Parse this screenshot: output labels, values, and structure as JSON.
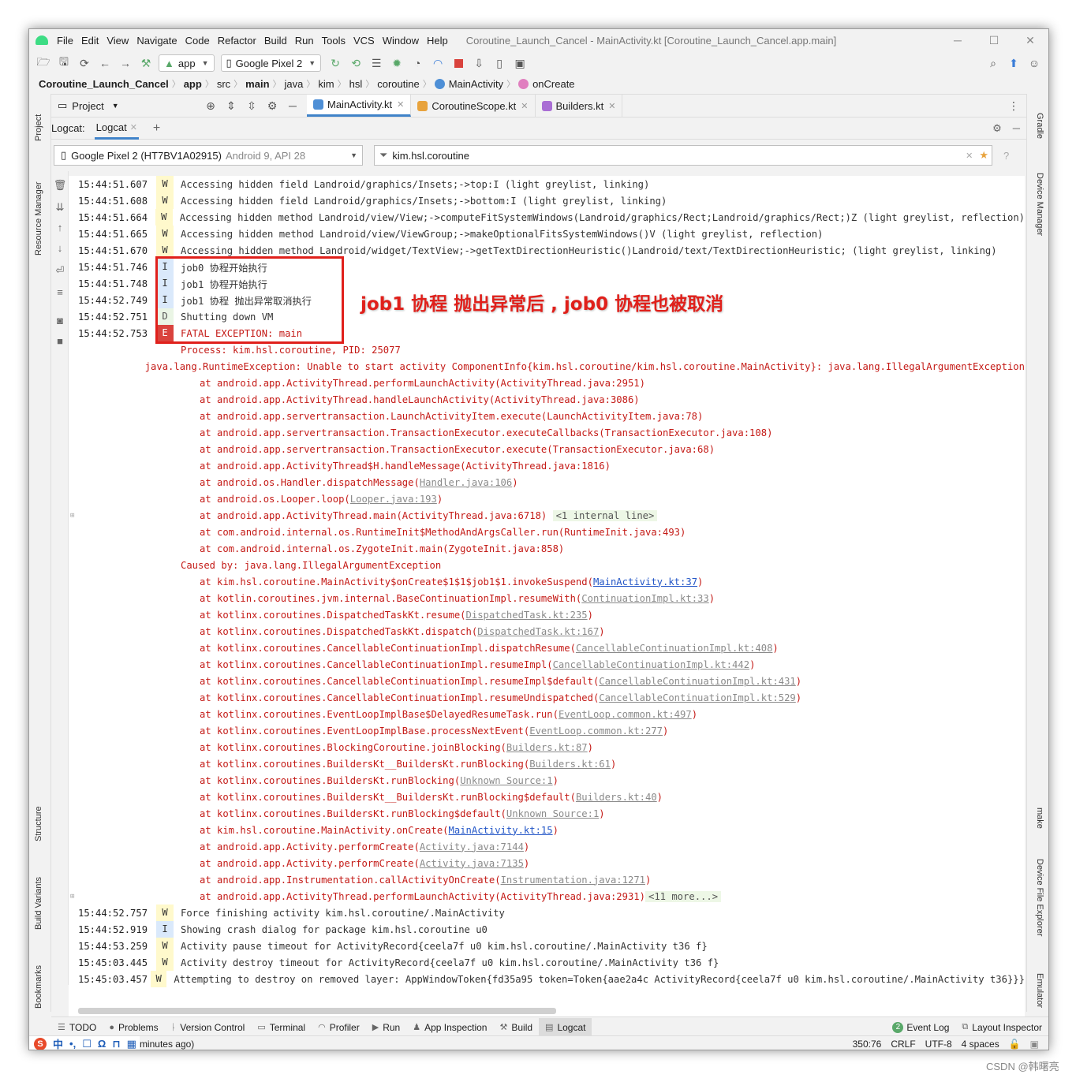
{
  "window": {
    "menus": [
      "File",
      "Edit",
      "View",
      "Navigate",
      "Code",
      "Refactor",
      "Build",
      "Run",
      "Tools",
      "VCS",
      "Window",
      "Help"
    ],
    "title": "Coroutine_Launch_Cancel - MainActivity.kt [Coroutine_Launch_Cancel.app.main]",
    "controls": {
      "min": "─",
      "max": "☐",
      "close": "✕"
    }
  },
  "toolbar": {
    "module": "app",
    "device": "Google Pixel 2"
  },
  "breadcrumb": [
    "Coroutine_Launch_Cancel",
    "app",
    "src",
    "main",
    "java",
    "kim",
    "hsl",
    "coroutine",
    "MainActivity",
    "onCreate"
  ],
  "project_tool": {
    "label": "Project"
  },
  "editor_tabs": [
    {
      "label": "MainActivity.kt",
      "color": "#4e8fd6"
    },
    {
      "label": "CoroutineScope.kt",
      "color": "#e8a33d"
    },
    {
      "label": "Builders.kt",
      "color": "#a96ed4"
    }
  ],
  "left_tools": [
    "Project",
    "Resource Manager",
    "Structure",
    "Build Variants",
    "Bookmarks"
  ],
  "right_tools": [
    "Gradle",
    "Device Manager",
    "make",
    "Device File Explorer",
    "Emulator"
  ],
  "logcat": {
    "header_label": "Logcat:",
    "tab": "Logcat",
    "device": "Google Pixel 2 (HT7BV1A02915)",
    "device_api": "Android 9, API 28",
    "filter": "kim.hsl.coroutine"
  },
  "annotation": "job1 协程 抛出异常后 , job0 协程也被取消",
  "log_rows": [
    {
      "ts": "15:44:51.607",
      "lvl": "W",
      "cls": "warn",
      "msg": "Accessing hidden field Landroid/graphics/Insets;->top:I (light greylist, linking)"
    },
    {
      "ts": "15:44:51.608",
      "lvl": "W",
      "cls": "warn",
      "msg": "Accessing hidden field Landroid/graphics/Insets;->bottom:I (light greylist, linking)"
    },
    {
      "ts": "15:44:51.664",
      "lvl": "W",
      "cls": "warn",
      "msg": "Accessing hidden method Landroid/view/View;->computeFitSystemWindows(Landroid/graphics/Rect;Landroid/graphics/Rect;)Z (light greylist, reflection)"
    },
    {
      "ts": "15:44:51.665",
      "lvl": "W",
      "cls": "warn",
      "msg": "Accessing hidden method Landroid/view/ViewGroup;->makeOptionalFitsSystemWindows()V (light greylist, reflection)"
    },
    {
      "ts": "15:44:51.670",
      "lvl": "W",
      "cls": "warn",
      "msg": "Accessing hidden method Landroid/widget/TextView;->getTextDirectionHeuristic()Landroid/text/TextDirectionHeuristic; (light greylist, linking)"
    },
    {
      "ts": "15:44:51.746",
      "lvl": "I",
      "cls": "warn",
      "msg": "job0 协程开始执行"
    },
    {
      "ts": "15:44:51.748",
      "lvl": "I",
      "cls": "warn",
      "msg": "job1 协程开始执行"
    },
    {
      "ts": "15:44:52.749",
      "lvl": "I",
      "cls": "warn",
      "msg": "job1 协程 抛出异常取消执行"
    },
    {
      "ts": "15:44:52.751",
      "lvl": "D",
      "cls": "warn",
      "msg": "Shutting down VM"
    },
    {
      "ts": "15:44:52.753",
      "lvl": "E",
      "cls": "err",
      "msg": "FATAL EXCEPTION: main"
    },
    {
      "ts": "",
      "lvl": "N",
      "cls": "err",
      "msg": "Process: kim.hsl.coroutine, PID: 25077"
    },
    {
      "ts": "",
      "lvl": "N",
      "cls": "err",
      "msg": "java.lang.RuntimeException: Unable to start activity ComponentInfo{kim.hsl.coroutine/kim.hsl.coroutine.MainActivity}: java.lang.IllegalArgumentException"
    },
    {
      "ts": "",
      "lvl": "N",
      "cls": "at",
      "msg": "at android.app.ActivityThread.performLaunchActivity(ActivityThread.java:2951)"
    },
    {
      "ts": "",
      "lvl": "N",
      "cls": "at",
      "msg": "at android.app.ActivityThread.handleLaunchActivity(ActivityThread.java:3086)"
    },
    {
      "ts": "",
      "lvl": "N",
      "cls": "at",
      "msg": "at android.app.servertransaction.LaunchActivityItem.execute(LaunchActivityItem.java:78)"
    },
    {
      "ts": "",
      "lvl": "N",
      "cls": "at",
      "msg": "at android.app.servertransaction.TransactionExecutor.executeCallbacks(TransactionExecutor.java:108)"
    },
    {
      "ts": "",
      "lvl": "N",
      "cls": "at",
      "msg": "at android.app.servertransaction.TransactionExecutor.execute(TransactionExecutor.java:68)"
    },
    {
      "ts": "",
      "lvl": "N",
      "cls": "at",
      "msg": "at android.app.ActivityThread$H.handleMessage(ActivityThread.java:1816)"
    },
    {
      "ts": "",
      "lvl": "N",
      "cls": "at",
      "msg": "at android.os.Handler.dispatchMessage(",
      "link": "Handler.java:106",
      "tail": ")"
    },
    {
      "ts": "",
      "lvl": "N",
      "cls": "at",
      "msg": "at android.os.Looper.loop(",
      "link": "Looper.java:193",
      "tail": ")"
    },
    {
      "ts": "",
      "lvl": "N",
      "cls": "at",
      "msg": "at android.app.ActivityThread.main(ActivityThread.java:6718) ",
      "inline": "<1 internal line>",
      "fold": true
    },
    {
      "ts": "",
      "lvl": "N",
      "cls": "at",
      "msg": "at com.android.internal.os.RuntimeInit$MethodAndArgsCaller.run(RuntimeInit.java:493)"
    },
    {
      "ts": "",
      "lvl": "N",
      "cls": "at",
      "msg": "at com.android.internal.os.ZygoteInit.main(ZygoteInit.java:858)"
    },
    {
      "ts": "",
      "lvl": "N",
      "cls": "err",
      "msg": "Caused by: java.lang.IllegalArgumentException"
    },
    {
      "ts": "",
      "lvl": "N",
      "cls": "at",
      "msg": "at kim.hsl.coroutine.MainActivity$onCreate$1$1$job1$1.invokeSuspend(",
      "link": "MainActivity.kt:37",
      "src": true,
      "tail": ")"
    },
    {
      "ts": "",
      "lvl": "N",
      "cls": "at",
      "msg": "at kotlin.coroutines.jvm.internal.BaseContinuationImpl.resumeWith(",
      "link": "ContinuationImpl.kt:33",
      "tail": ")"
    },
    {
      "ts": "",
      "lvl": "N",
      "cls": "at",
      "msg": "at kotlinx.coroutines.DispatchedTaskKt.resume(",
      "link": "DispatchedTask.kt:235",
      "tail": ")"
    },
    {
      "ts": "",
      "lvl": "N",
      "cls": "at",
      "msg": "at kotlinx.coroutines.DispatchedTaskKt.dispatch(",
      "link": "DispatchedTask.kt:167",
      "tail": ")"
    },
    {
      "ts": "",
      "lvl": "N",
      "cls": "at",
      "msg": "at kotlinx.coroutines.CancellableContinuationImpl.dispatchResume(",
      "link": "CancellableContinuationImpl.kt:408",
      "tail": ")"
    },
    {
      "ts": "",
      "lvl": "N",
      "cls": "at",
      "msg": "at kotlinx.coroutines.CancellableContinuationImpl.resumeImpl(",
      "link": "CancellableContinuationImpl.kt:442",
      "tail": ")"
    },
    {
      "ts": "",
      "lvl": "N",
      "cls": "at",
      "msg": "at kotlinx.coroutines.CancellableContinuationImpl.resumeImpl$default(",
      "link": "CancellableContinuationImpl.kt:431",
      "tail": ")"
    },
    {
      "ts": "",
      "lvl": "N",
      "cls": "at",
      "msg": "at kotlinx.coroutines.CancellableContinuationImpl.resumeUndispatched(",
      "link": "CancellableContinuationImpl.kt:529",
      "tail": ")"
    },
    {
      "ts": "",
      "lvl": "N",
      "cls": "at",
      "msg": "at kotlinx.coroutines.EventLoopImplBase$DelayedResumeTask.run(",
      "link": "EventLoop.common.kt:497",
      "tail": ")"
    },
    {
      "ts": "",
      "lvl": "N",
      "cls": "at",
      "msg": "at kotlinx.coroutines.EventLoopImplBase.processNextEvent(",
      "link": "EventLoop.common.kt:277",
      "tail": ")"
    },
    {
      "ts": "",
      "lvl": "N",
      "cls": "at",
      "msg": "at kotlinx.coroutines.BlockingCoroutine.joinBlocking(",
      "link": "Builders.kt:87",
      "tail": ")"
    },
    {
      "ts": "",
      "lvl": "N",
      "cls": "at",
      "msg": "at kotlinx.coroutines.BuildersKt__BuildersKt.runBlocking(",
      "link": "Builders.kt:61",
      "tail": ")"
    },
    {
      "ts": "",
      "lvl": "N",
      "cls": "at",
      "msg": "at kotlinx.coroutines.BuildersKt.runBlocking(",
      "link": "Unknown Source:1",
      "tail": ")"
    },
    {
      "ts": "",
      "lvl": "N",
      "cls": "at",
      "msg": "at kotlinx.coroutines.BuildersKt__BuildersKt.runBlocking$default(",
      "link": "Builders.kt:40",
      "tail": ")"
    },
    {
      "ts": "",
      "lvl": "N",
      "cls": "at",
      "msg": "at kotlinx.coroutines.BuildersKt.runBlocking$default(",
      "link": "Unknown Source:1",
      "tail": ")"
    },
    {
      "ts": "",
      "lvl": "N",
      "cls": "at",
      "msg": "at kim.hsl.coroutine.MainActivity.onCreate(",
      "link": "MainActivity.kt:15",
      "src": true,
      "tail": ")"
    },
    {
      "ts": "",
      "lvl": "N",
      "cls": "at",
      "msg": "at android.app.Activity.performCreate(",
      "link": "Activity.java:7144",
      "tail": ")"
    },
    {
      "ts": "",
      "lvl": "N",
      "cls": "at",
      "msg": "at android.app.Activity.performCreate(",
      "link": "Activity.java:7135",
      "tail": ")"
    },
    {
      "ts": "",
      "lvl": "N",
      "cls": "at",
      "msg": "at android.app.Instrumentation.callActivityOnCreate(",
      "link": "Instrumentation.java:1271",
      "tail": ")"
    },
    {
      "ts": "",
      "lvl": "N",
      "cls": "at",
      "msg": "at android.app.ActivityThread.performLaunchActivity(ActivityThread.java:2931)",
      "inline": "<11 more...>",
      "fold": true
    },
    {
      "ts": "15:44:52.757",
      "lvl": "W",
      "cls": "warn",
      "msg": "  Force finishing activity kim.hsl.coroutine/.MainActivity"
    },
    {
      "ts": "15:44:52.919",
      "lvl": "I",
      "cls": "warn",
      "msg": "Showing crash dialog for package kim.hsl.coroutine u0"
    },
    {
      "ts": "15:44:53.259",
      "lvl": "W",
      "cls": "warn",
      "msg": "Activity pause timeout for ActivityRecord{ceela7f u0 kim.hsl.coroutine/.MainActivity t36 f}"
    },
    {
      "ts": "15:45:03.445",
      "lvl": "W",
      "cls": "warn",
      "msg": "Activity destroy timeout for ActivityRecord{ceela7f u0 kim.hsl.coroutine/.MainActivity t36 f}"
    },
    {
      "ts": "15:45:03.457",
      "lvl": "W",
      "cls": "warn",
      "msg": "Attempting to destroy on removed layer: AppWindowToken{fd35a95 token=Token{aae2a4c ActivityRecord{ceela7f u0 kim.hsl.coroutine/.MainActivity t36}}}"
    }
  ],
  "bottom_tabs": [
    {
      "label": "TODO",
      "icon": "☰"
    },
    {
      "label": "Problems",
      "icon": "●"
    },
    {
      "label": "Version Control",
      "icon": "ᚿ"
    },
    {
      "label": "Terminal",
      "icon": "▭"
    },
    {
      "label": "Profiler",
      "icon": "◠"
    },
    {
      "label": "Run",
      "icon": "▶"
    },
    {
      "label": "App Inspection",
      "icon": "♟"
    },
    {
      "label": "Build",
      "icon": "⚒"
    },
    {
      "label": "Logcat",
      "icon": "▤",
      "active": true
    }
  ],
  "bottom_right_tabs": [
    {
      "label": "Event Log",
      "badge": "2"
    },
    {
      "label": "Layout Inspector"
    }
  ],
  "status": {
    "ime": [
      "中",
      "•,",
      "☐",
      "Ω",
      "⊓",
      "▦"
    ],
    "message": "minutes ago)",
    "position": "350:76",
    "line_sep": "CRLF",
    "encoding": "UTF-8",
    "indent": "4 spaces"
  },
  "watermark": "CSDN @韩曙亮"
}
